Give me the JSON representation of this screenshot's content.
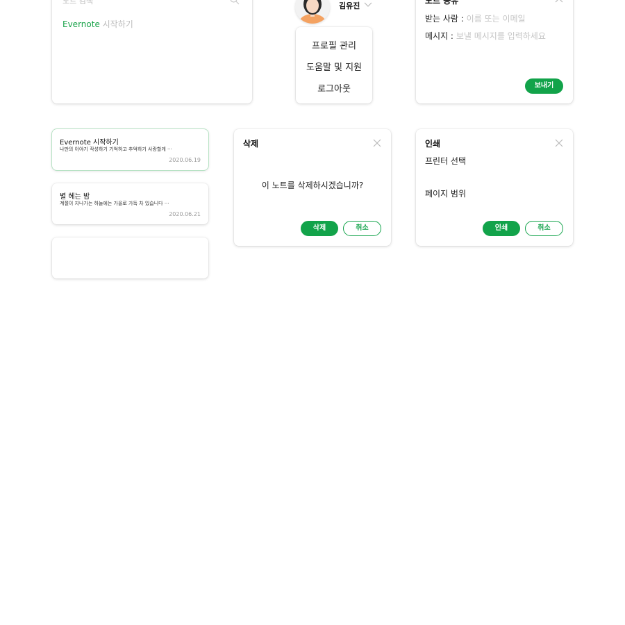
{
  "colors": {
    "accent": "#12a34a",
    "highlight": "#1aa34a"
  },
  "search": {
    "placeholder": "노트 검색",
    "result_highlight": "Evernote",
    "result_rest": " 시작하기"
  },
  "profile": {
    "name": "김유진",
    "menu": [
      "프로필 관리",
      "도움말 및 지원",
      "로그아웃"
    ]
  },
  "share": {
    "title": "노트 공유",
    "recipient_label": "받는 사람 :",
    "recipient_placeholder": "이름 또는 이메일",
    "message_label": "메시지 :",
    "message_placeholder": "보낼 메시지를 입력하세요",
    "send_label": "보내기"
  },
  "notes": [
    {
      "title": "Evernote 시작하기",
      "body": "나만의 이야기 작성하기 기억하고 추억하기 사랑할게 ···",
      "date": "2020.06.19"
    },
    {
      "title": "별 헤는 밤",
      "body": "계절이 지나가는 하늘에는 가을로 가득 차 있습니다 ···",
      "date": "2020.06.21"
    },
    {
      "title": "",
      "body": "",
      "date": ""
    }
  ],
  "delete_dialog": {
    "title": "삭제",
    "message": "이 노트를 삭제하시겠습니까?",
    "confirm_label": "삭제",
    "cancel_label": "취소"
  },
  "print_dialog": {
    "title": "인쇄",
    "printer_label": "프린터 선택",
    "range_label": "페이지 범위",
    "confirm_label": "인쇄",
    "cancel_label": "취소"
  }
}
